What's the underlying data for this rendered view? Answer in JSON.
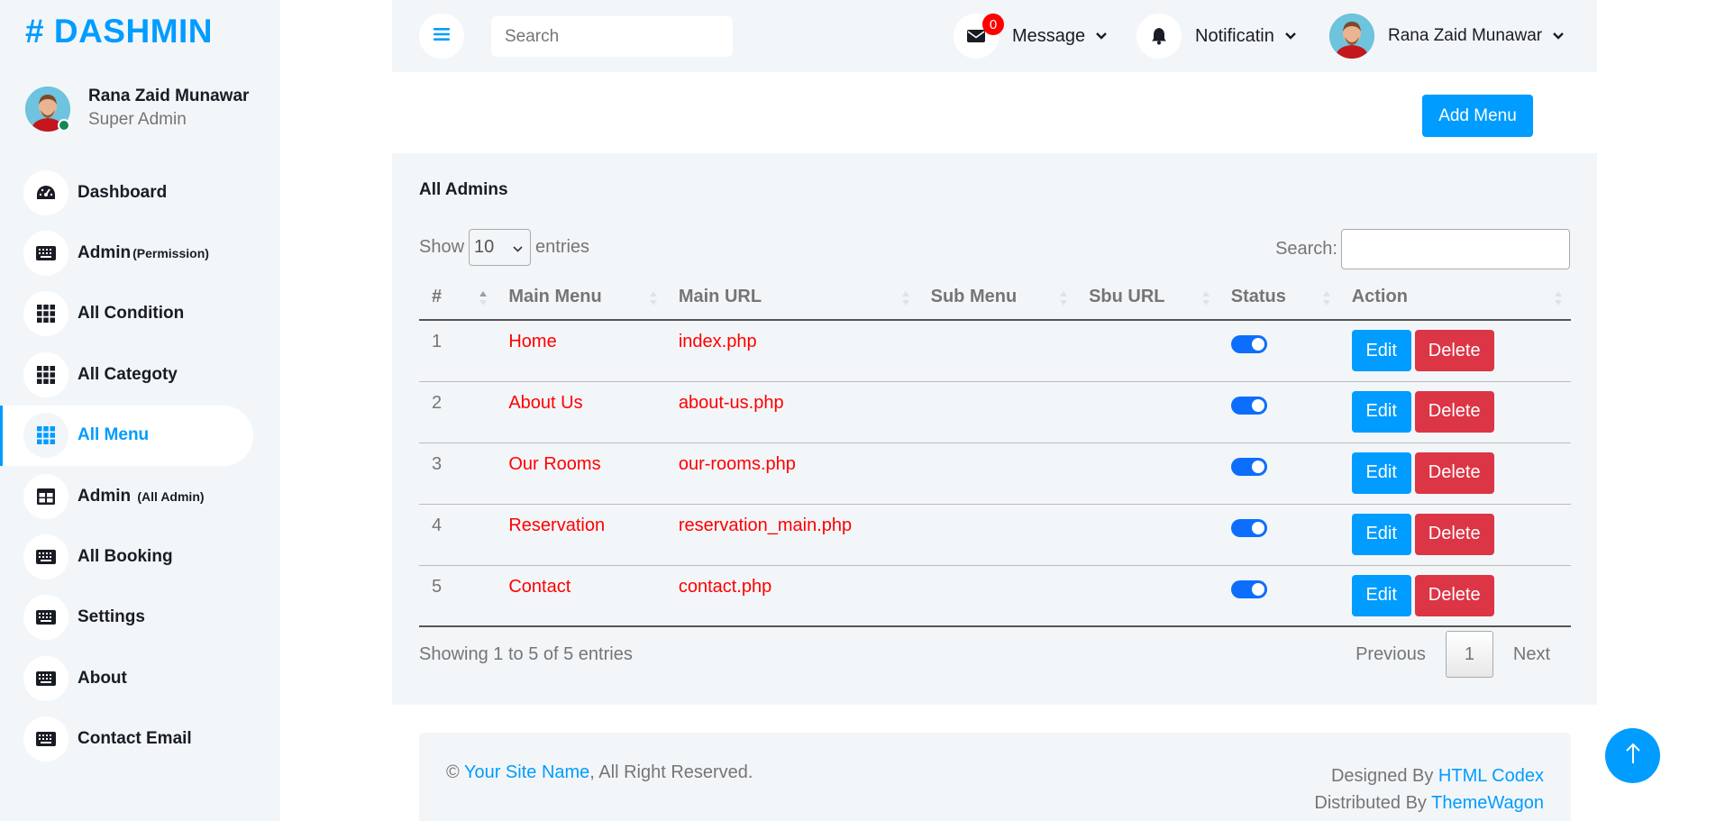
{
  "brand": "# DASHMIN",
  "profile": {
    "name": "Rana Zaid Munawar",
    "role": "Super Admin"
  },
  "sidebar": {
    "items": [
      {
        "label": "Dashboard",
        "sub": "",
        "icon": "tachometer-icon"
      },
      {
        "label": "Admin",
        "sub": "(Permission)",
        "icon": "keyboard-icon"
      },
      {
        "label": "All Condition",
        "sub": "",
        "icon": "grid-icon"
      },
      {
        "label": "All Categoty",
        "sub": "",
        "icon": "grid-icon"
      },
      {
        "label": "All Menu",
        "sub": "",
        "icon": "grid-icon",
        "active": true
      },
      {
        "label": "Admin",
        "sub": "(All Admin)",
        "icon": "table-icon"
      },
      {
        "label": "All Booking",
        "sub": "",
        "icon": "keyboard-icon"
      },
      {
        "label": "Settings",
        "sub": "",
        "icon": "keyboard-icon"
      },
      {
        "label": "About",
        "sub": "",
        "icon": "keyboard-icon"
      },
      {
        "label": "Contact Email",
        "sub": "",
        "icon": "keyboard-icon"
      }
    ]
  },
  "topbar": {
    "search_placeholder": "Search",
    "message_label": "Message",
    "message_count": "0",
    "notification_label": "Notificatin",
    "user_name": "Rana Zaid Munawar"
  },
  "toolbar": {
    "add_menu_label": "Add Menu"
  },
  "table_card": {
    "title": "All Admins",
    "show_label": "Show",
    "entries_label": "entries",
    "page_length": "10",
    "search_label": "Search:",
    "columns": [
      "#",
      "Main Menu",
      "Main URL",
      "Sub Menu",
      "Sbu URL",
      "Status",
      "Action"
    ],
    "rows": [
      {
        "num": "1",
        "main_menu": "Home",
        "main_url": "index.php",
        "sub_menu": "",
        "sub_url": "",
        "status": true
      },
      {
        "num": "2",
        "main_menu": "About Us",
        "main_url": "about-us.php",
        "sub_menu": "",
        "sub_url": "",
        "status": true
      },
      {
        "num": "3",
        "main_menu": "Our Rooms",
        "main_url": "our-rooms.php",
        "sub_menu": "",
        "sub_url": "",
        "status": true
      },
      {
        "num": "4",
        "main_menu": "Reservation",
        "main_url": "reservation_main.php",
        "sub_menu": "",
        "sub_url": "",
        "status": true
      },
      {
        "num": "5",
        "main_menu": "Contact",
        "main_url": "contact.php",
        "sub_menu": "",
        "sub_url": "",
        "status": true
      }
    ],
    "edit_label": "Edit",
    "delete_label": "Delete",
    "info": "Showing 1 to 5 of 5 entries",
    "prev_label": "Previous",
    "current_page": "1",
    "next_label": "Next"
  },
  "footer": {
    "copyright_symbol": "©",
    "site_name": "Your Site Name",
    "rights": ", All Right Reserved.",
    "designed_by": "Designed By",
    "designer": "HTML Codex",
    "distributed_by": "Distributed By",
    "distributor": "ThemeWagon"
  },
  "colors": {
    "primary": "#009cff",
    "danger": "#dc3545",
    "row_text": "#ff0000",
    "panel_bg": "#f3f6f9"
  }
}
